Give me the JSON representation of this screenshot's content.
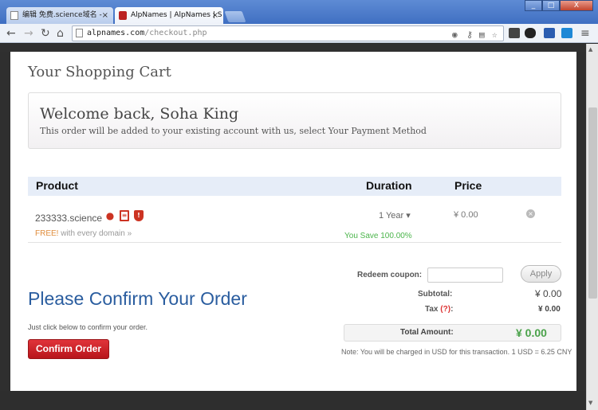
{
  "browser": {
    "tabs": [
      {
        "label": "编辑 免费.science域名 -",
        "close": "×"
      },
      {
        "label": "AlpNames | AlpNames | S",
        "close": "×"
      }
    ],
    "window_buttons": [
      "_",
      "□",
      "X"
    ],
    "url_host": "alpnames.com",
    "url_path": "/checkout.php"
  },
  "page": {
    "cart_title": "Your Shopping Cart",
    "welcome_title": "Welcome back, Soha King",
    "welcome_text": "This order will be added to your existing account with us, select Your Payment Method",
    "table_headers": {
      "product": "Product",
      "duration": "Duration",
      "price": "Price"
    },
    "item": {
      "domain": "233333.science",
      "free_tag": "FREE!",
      "free_text": "with every domain »",
      "duration": "1 Year ▾",
      "you_save": "You Save 100.00%",
      "price": "¥ 0.00",
      "remove": "×"
    },
    "coupon": {
      "label": "Redeem coupon:",
      "value": "",
      "apply": "Apply"
    },
    "confirm_title": "Please Confirm Your Order",
    "subtotal_label": "Subtotal:",
    "subtotal_value": "¥ 0.00",
    "tax_label": "Tax",
    "tax_q": "(?)",
    "tax_colon": ":",
    "tax_value": "¥ 0.00",
    "click_note": "Just click below to confirm your order.",
    "confirm_button": "Confirm Order",
    "total_label": "Total Amount:",
    "total_value": "¥ 0.00",
    "usd_note": "Note: You will be charged in USD for this transaction. 1 USD = 6.25 CNY"
  },
  "colors": {
    "accent": "#2a5d9f",
    "confirm": "#c81e24",
    "success": "#4aa24a"
  }
}
